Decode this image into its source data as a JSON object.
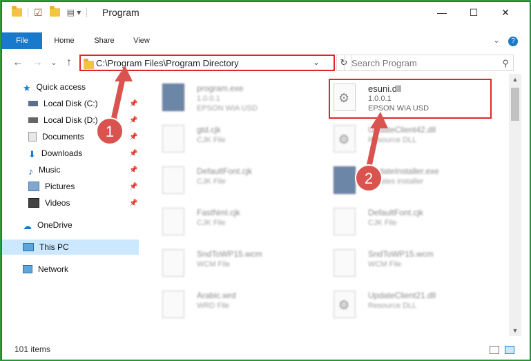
{
  "window": {
    "title": "Program"
  },
  "ribbon": {
    "tabs": [
      "File",
      "Home",
      "Share",
      "View"
    ]
  },
  "nav": {
    "address": "C:\\Program Files\\Program Directory",
    "search_placeholder": "Search Program"
  },
  "sidebar": {
    "items": [
      {
        "label": "Quick access"
      },
      {
        "label": "Local Disk (C:)"
      },
      {
        "label": "Local Disk (D:)"
      },
      {
        "label": "Documents"
      },
      {
        "label": "Downloads"
      },
      {
        "label": "Music"
      },
      {
        "label": "Pictures"
      },
      {
        "label": "Videos"
      },
      {
        "label": "OneDrive"
      },
      {
        "label": "This PC"
      },
      {
        "label": "Network"
      }
    ]
  },
  "files": [
    {
      "name": "program.exe",
      "line2": "1.0.0.1",
      "line3": "EPSON WIA USD"
    },
    {
      "name": "esuni.dll",
      "line2": "1.0.0.1",
      "line3": "EPSON WIA USD"
    },
    {
      "name": "gtd.cjk",
      "line2": "CJK File",
      "line3": ""
    },
    {
      "name": "UpdateClient42.dll",
      "line2": "Resource DLL",
      "line3": ""
    },
    {
      "name": "DefaultFont.cjk",
      "line2": "CJK File",
      "line3": ""
    },
    {
      "name": "UpdateInstaller.exe",
      "line2": "updates installer",
      "line3": ""
    },
    {
      "name": "FastNml.cjk",
      "line2": "CJK File",
      "line3": ""
    },
    {
      "name": "DefaultFont.cjk",
      "line2": "CJK File",
      "line3": ""
    },
    {
      "name": "SndToWP15.wcm",
      "line2": "WCM File",
      "line3": ""
    },
    {
      "name": "SndToWP15.wcm",
      "line2": "WCM File",
      "line3": ""
    },
    {
      "name": "Arabic.wrd",
      "line2": "WRD File",
      "line3": ""
    },
    {
      "name": "UpdateClient21.dll",
      "line2": "Resource DLL",
      "line3": ""
    }
  ],
  "annotations": {
    "step1": "1",
    "step2": "2"
  },
  "status": {
    "count": "101 items"
  }
}
